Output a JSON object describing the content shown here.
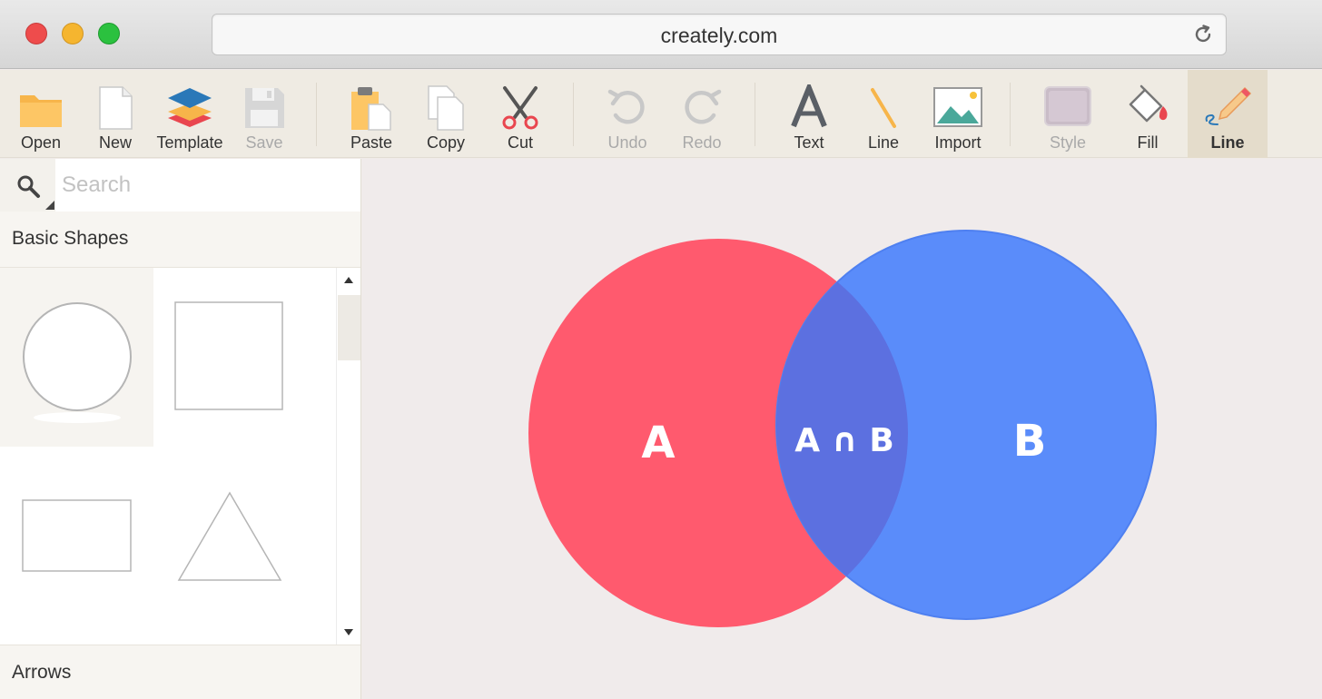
{
  "browser": {
    "url": "creately.com"
  },
  "toolbar": {
    "open": "Open",
    "new": "New",
    "template": "Template",
    "save": "Save",
    "paste": "Paste",
    "copy": "Copy",
    "cut": "Cut",
    "undo": "Undo",
    "redo": "Redo",
    "text": "Text",
    "line": "Line",
    "import": "Import",
    "style": "Style",
    "fill": "Fill",
    "line_active": "Line"
  },
  "sidebar": {
    "search_placeholder": "Search",
    "sections": {
      "basic_shapes": "Basic Shapes",
      "arrows": "Arrows"
    },
    "shapes": [
      "circle",
      "square",
      "rectangle",
      "triangle"
    ]
  },
  "canvas": {
    "venn": {
      "label_a": "A",
      "label_intersection": "A ∩ B",
      "label_b": "B",
      "color_a": "#ff5a6e",
      "color_b": "#5a8cfa",
      "color_overlap": "#5c70e0"
    }
  },
  "colors": {
    "toolbar_bg": "#efebe3",
    "canvas_bg": "#f0ebeb",
    "active_tool_bg": "#e4dccb"
  }
}
